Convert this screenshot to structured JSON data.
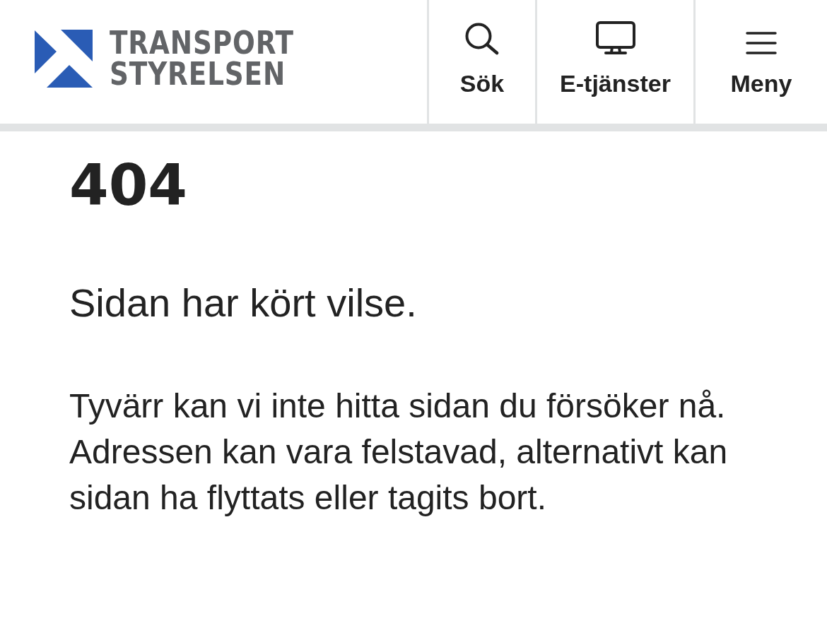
{
  "header": {
    "logo": {
      "lines": [
        "TRANSPORT",
        "STYRELSEN"
      ]
    },
    "actions": [
      {
        "kind": "search",
        "label": "Sök"
      },
      {
        "kind": "eservices",
        "label": "E-tjänster"
      },
      {
        "kind": "menu",
        "label": "Meny"
      }
    ]
  },
  "main": {
    "code": "404",
    "heading": "Sidan har kört vilse.",
    "body": "Tyvärr kan vi inte hitta sidan du försöker nå. Adressen kan vara felstavad, alternativt kan sidan ha flyttats eller tagits bort."
  }
}
